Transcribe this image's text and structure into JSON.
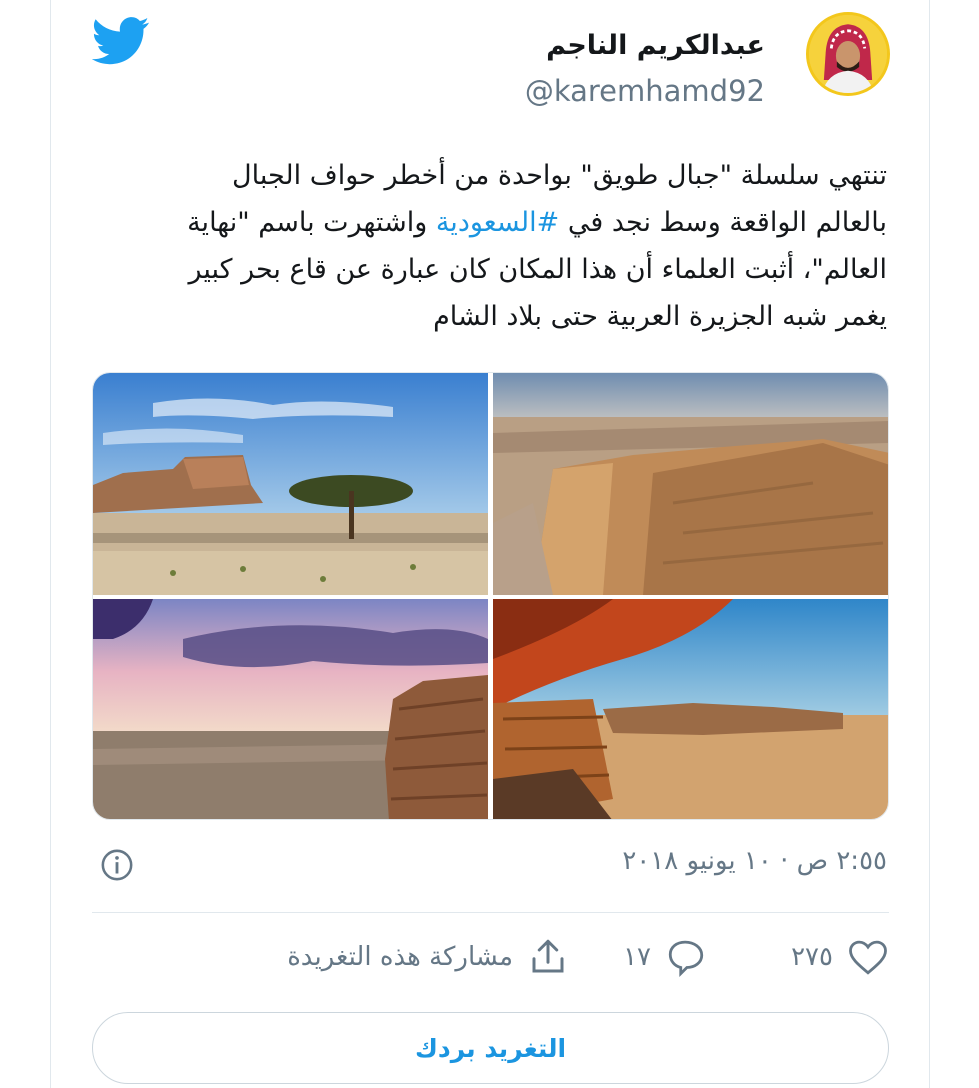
{
  "user": {
    "display_name": "عبدالكريم الناجم",
    "handle": "@karemhamd92"
  },
  "tweet": {
    "lines": [
      {
        "before": "تنتهي سلسلة \"جبال طويق\" بواحدة من أخطر حواف الجبال"
      },
      {
        "before": "بالعالم الواقعة وسط نجد في ",
        "hashtag": "#السعودية",
        "after": " واشتهرت باسم \"نهاية"
      },
      {
        "before": "العالم\"، أثبت العلماء أن هذا المكان كان عبارة عن قاع بحر كبير"
      },
      {
        "before": "يغمر شبه الجزيرة العربية حتى بلاد الشام"
      }
    ]
  },
  "timestamp": "٢:٥٥ ص · ١٠ يونيو ٢٠١٨",
  "actions": {
    "like_count": "٢٧٥",
    "reply_count": "١٧",
    "share_label": "مشاركة هذه التغريدة"
  },
  "reply_button_label": "التغريد بردك",
  "colors": {
    "twitter_blue": "#1da1f2",
    "link_blue": "#1b95e0",
    "muted_gray": "#657786",
    "divider": "#e1e8ed"
  },
  "icons": [
    "twitter-bird-icon",
    "info-icon",
    "heart-icon",
    "reply-bubble-icon",
    "share-icon"
  ]
}
